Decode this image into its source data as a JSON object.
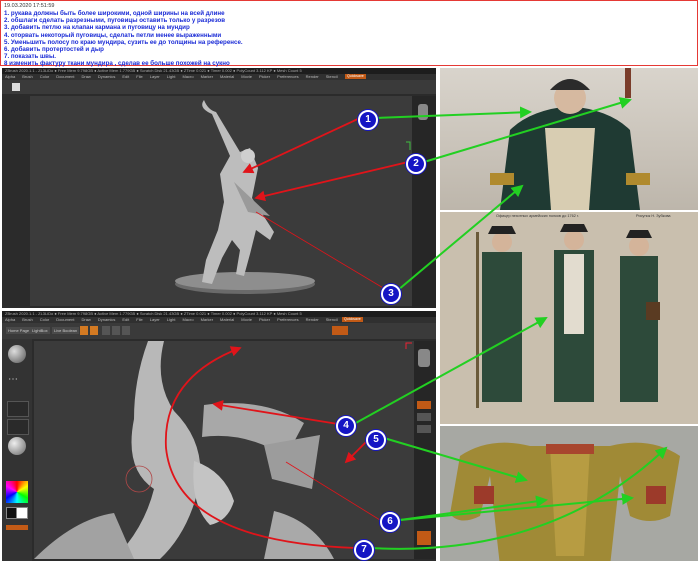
{
  "notes": {
    "timestamp": "19.03.2020 17:51:59",
    "items": [
      "1. рукава должны быть более широкими, одной  ширины на всей длине",
      "2. обшлаги сделать разрезными, пуговицы оставить только у разрезов",
      "3. добавить  петлю на клапан кармана и пуговицу на мундир",
      "4.   оторвать некоторый пуговицы, сделать петли менее выраженными",
      "5. Уменьшить полосу по краю мундира, сузить ее до толщины на референсе.",
      "6. добавить протертостей и дыр",
      "7. показать швы.",
      "8 изменить фактуру ткани мундира , сделав ее больше похожей на сукно"
    ]
  },
  "zbrush_top": {
    "title": "ZBrush 2020.1.1 - ZL3LiDo      ● Free Mem 9.798GB ● Active Mem 1.779GB ● Scratch Disk 21.43GB ● ZTime 0.021 ● Timer 0.002 ● PolyCount 3.112 KP ● Mesh Count 5",
    "menu": [
      "Alpha",
      "Brush",
      "Color",
      "Document",
      "Draw",
      "Dynamics",
      "Edit",
      "File",
      "Layer",
      "Light",
      "Macro",
      "Marker",
      "Material",
      "Movie",
      "Picker",
      "Preferences",
      "Render",
      "Stencil",
      "Stroke",
      "Texture",
      "Tool",
      "Transform",
      "Zplugin",
      "Zscript",
      "Help"
    ],
    "badge": "Quicksave"
  },
  "zbrush_bot": {
    "title": "ZBrush 2020.1.1 - ZL3LiDo      ● Free Mem 9.798GB ● Active Mem 1.779GB ● Scratch Disk 21.43GB ● ZTime 0.021 ● Timer 0.002 ● PolyCount 3.112 KP ● Mesh Count 5",
    "menu": [
      "Alpha",
      "Brush",
      "Color",
      "Document",
      "Draw",
      "Dynamics",
      "Edit",
      "File",
      "Layer",
      "Light",
      "Macro",
      "Marker",
      "Material",
      "Movie",
      "Picker",
      "Preferences",
      "Render",
      "Stencil",
      "Stroke",
      "Texture",
      "Tool",
      "Transform",
      "Zplugin",
      "Zscript",
      "Help"
    ],
    "badge": "Quicksave",
    "shelf_buttons": [
      "Home Page",
      "LightBox",
      "Live Boolean",
      "Edit",
      "Draw",
      "Move",
      "Scale",
      "Rotate"
    ]
  },
  "photos": {
    "caption_left": "Офицер пехотных армейских полков до 1762 г.",
    "caption_right": "Рисунок Н. Зубкова"
  },
  "markers": [
    "1",
    "2",
    "3",
    "4",
    "5",
    "6",
    "6",
    "7"
  ],
  "colors": {
    "note_text": "#1a2bd6",
    "note_border": "#e53935",
    "marker_fill": "#1515c4",
    "arrow_green": "#22d022",
    "arrow_red": "#e0141a"
  }
}
